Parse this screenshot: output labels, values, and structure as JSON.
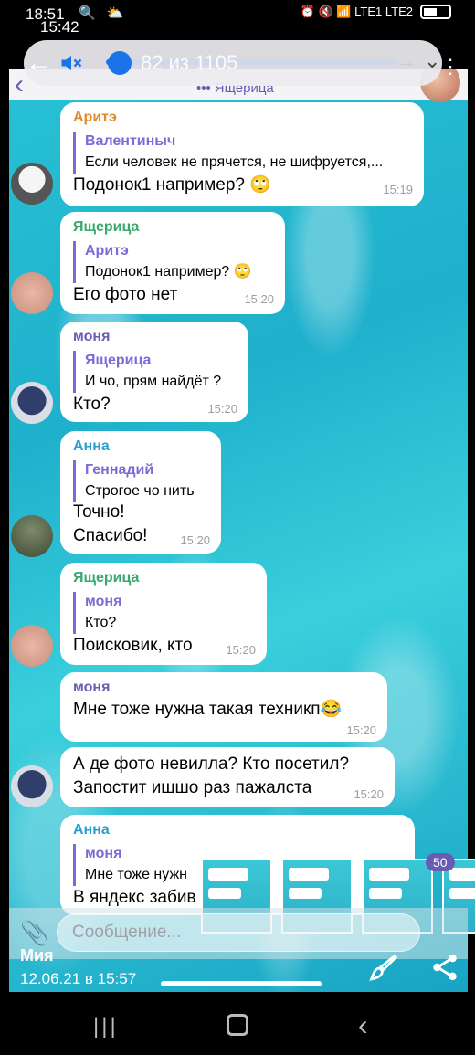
{
  "status_bar": {
    "time": "18:51",
    "time_overlay": "15:42",
    "left_icons": "🔍 ⛅",
    "right_icons": "⏰ 🔇 📶 LTE1 LTE2"
  },
  "chat_header": {
    "subtitle": "Ящерица",
    "dots": "•••"
  },
  "overlay_bar": {
    "counter_text": "82 из 1105",
    "counter_fraction": 0.074
  },
  "messages": [
    {
      "sender": "Аритэ",
      "sender_color": "#e08a2e",
      "quote_name": "Валентиныч",
      "quote_text": "Если человек не прячется, не шифруется,...",
      "text": "Подонок1 например? 🙄",
      "time": "15:19"
    },
    {
      "sender": "Ящерица",
      "sender_color": "#3aa76d",
      "quote_name": "Аритэ",
      "quote_text": "Подонок1 например? 🙄",
      "text": "Его фото нет",
      "time": "15:20"
    },
    {
      "sender": "моня",
      "sender_color": "#6a5bb3",
      "quote_name": "Ящерица",
      "quote_text": "И чо, прям найдёт ?",
      "text": "Кто?",
      "time": "15:20"
    },
    {
      "sender": "Анна",
      "sender_color": "#2b9fd0",
      "quote_name": "Геннадий",
      "quote_text": "Строгое чо нить",
      "text_line1": "Точно!",
      "text_line2": "Спасибо!",
      "time": "15:20"
    },
    {
      "sender": "Ящерица",
      "sender_color": "#3aa76d",
      "quote_name": "моня",
      "quote_text": "Кто?",
      "text": "Поисковик, кто",
      "time": "15:20"
    },
    {
      "sender": "моня",
      "sender_color": "#6a5bb3",
      "text": "Мне тоже нужна такая техникп😂",
      "time": "15:20"
    },
    {
      "text_line1": "А де фото невилла? Кто посетил?",
      "text_line2": "Запостит ишшо раз пажалста",
      "time": "15:20"
    },
    {
      "sender": "Анна",
      "sender_color": "#2b9fd0",
      "quote_name": "моня",
      "quote_text": "Мне тоже нужн",
      "text": "В яндекс забив"
    }
  ],
  "composer": {
    "placeholder": "Сообщение...",
    "badge": "50"
  },
  "caption": {
    "name": "Мия",
    "date": "12.06.21 в 15:57"
  },
  "colors": {
    "accent": "#6a5bb3",
    "quote_bar": "#7c6bd6",
    "progress": "#1a73e8"
  }
}
